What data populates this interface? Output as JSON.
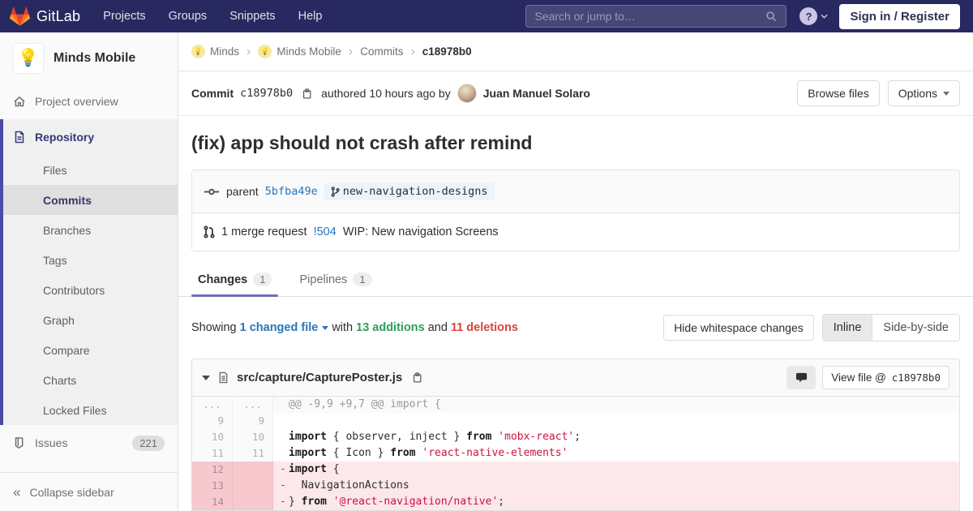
{
  "colors": {
    "navbar_bg": "#292961",
    "accent_purple": "#6e6eb8",
    "sidebar_active_indigo": "#4b4ba3",
    "link_blue": "#2776bd",
    "addition_green": "#2e9e5b",
    "deletion_red": "#d9453c",
    "string_red": "#d01040",
    "logo_red": "#e24329",
    "logo_orange": "#fc6d26",
    "logo_yellow": "#fca326"
  },
  "navbar": {
    "brand": "GitLab",
    "links": [
      "Projects",
      "Groups",
      "Snippets",
      "Help"
    ],
    "search_placeholder": "Search or jump to…",
    "help_label": "?",
    "signin_label": "Sign in / Register"
  },
  "sidebar": {
    "project_name": "Minds Mobile",
    "project_avatar_emoji": "💡",
    "overview_label": "Project overview",
    "repository_label": "Repository",
    "repo_items": [
      "Files",
      "Commits",
      "Branches",
      "Tags",
      "Contributors",
      "Graph",
      "Compare",
      "Charts",
      "Locked Files"
    ],
    "active_repo_item": "Commits",
    "issues_label": "Issues",
    "issues_count": "221",
    "collapse_label": "Collapse sidebar"
  },
  "breadcrumb": {
    "items": [
      {
        "label": "Minds",
        "avatar": true
      },
      {
        "label": "Minds Mobile",
        "avatar": true
      },
      {
        "label": "Commits",
        "avatar": false
      }
    ],
    "current": "c18978b0"
  },
  "commit": {
    "label": "Commit",
    "sha_short": "c18978b0",
    "authored_text": "authored 10 hours ago by",
    "author_name": "Juan Manuel Solaro",
    "browse_files_label": "Browse files",
    "options_label": "Options",
    "title": "(fix) app should not crash after remind",
    "parent_label": "parent",
    "parent_sha": "5bfba49e",
    "branch_name": "new-navigation-designs",
    "mr_count_text": "1 merge request",
    "mr_ref": "!504",
    "mr_title": "WIP: New navigation Screens"
  },
  "tabs": [
    {
      "label": "Changes",
      "badge": "1",
      "active": true
    },
    {
      "label": "Pipelines",
      "badge": "1",
      "active": false
    }
  ],
  "diff_summary": {
    "showing": "Showing",
    "changed_files": "1 changed file",
    "with_text": "with",
    "additions": "13 additions",
    "and_text": "and",
    "deletions": "11 deletions",
    "hide_whitespace": "Hide whitespace changes",
    "inline": "Inline",
    "side_by_side": "Side-by-side"
  },
  "file": {
    "path": "src/capture/CapturePoster.js",
    "view_file_label": "View file @",
    "view_file_sha": "c18978b0"
  },
  "diff": {
    "lines": [
      {
        "old": "...",
        "new": "...",
        "type": "match",
        "prefix": "",
        "segments": [
          {
            "t": "@@ -9,9 +9,7 @@ import {",
            "c": "hunk"
          }
        ]
      },
      {
        "old": "9",
        "new": "9",
        "type": "ctx",
        "prefix": " ",
        "segments": []
      },
      {
        "old": "10",
        "new": "10",
        "type": "ctx",
        "prefix": " ",
        "segments": [
          {
            "t": "import",
            "c": "k"
          },
          {
            "t": " { observer, inject } ",
            "c": "p"
          },
          {
            "t": "from",
            "c": "k"
          },
          {
            "t": " ",
            "c": "p"
          },
          {
            "t": "'mobx-react'",
            "c": "s"
          },
          {
            "t": ";",
            "c": "p"
          }
        ]
      },
      {
        "old": "11",
        "new": "11",
        "type": "ctx",
        "prefix": " ",
        "segments": [
          {
            "t": "import",
            "c": "k"
          },
          {
            "t": " { Icon } ",
            "c": "p"
          },
          {
            "t": "from",
            "c": "k"
          },
          {
            "t": " ",
            "c": "p"
          },
          {
            "t": "'react-native-elements'",
            "c": "s"
          }
        ]
      },
      {
        "old": "12",
        "new": "",
        "type": "del",
        "prefix": "-",
        "segments": [
          {
            "t": "import",
            "c": "k"
          },
          {
            "t": " {",
            "c": "p"
          }
        ]
      },
      {
        "old": "13",
        "new": "",
        "type": "del",
        "prefix": "-",
        "segments": [
          {
            "t": "  NavigationActions",
            "c": "p"
          }
        ]
      },
      {
        "old": "14",
        "new": "",
        "type": "del",
        "prefix": "-",
        "segments": [
          {
            "t": "} ",
            "c": "p"
          },
          {
            "t": "from",
            "c": "k"
          },
          {
            "t": " ",
            "c": "p"
          },
          {
            "t": "'@react-navigation/native'",
            "c": "s"
          },
          {
            "t": ";",
            "c": "p"
          }
        ]
      }
    ]
  }
}
